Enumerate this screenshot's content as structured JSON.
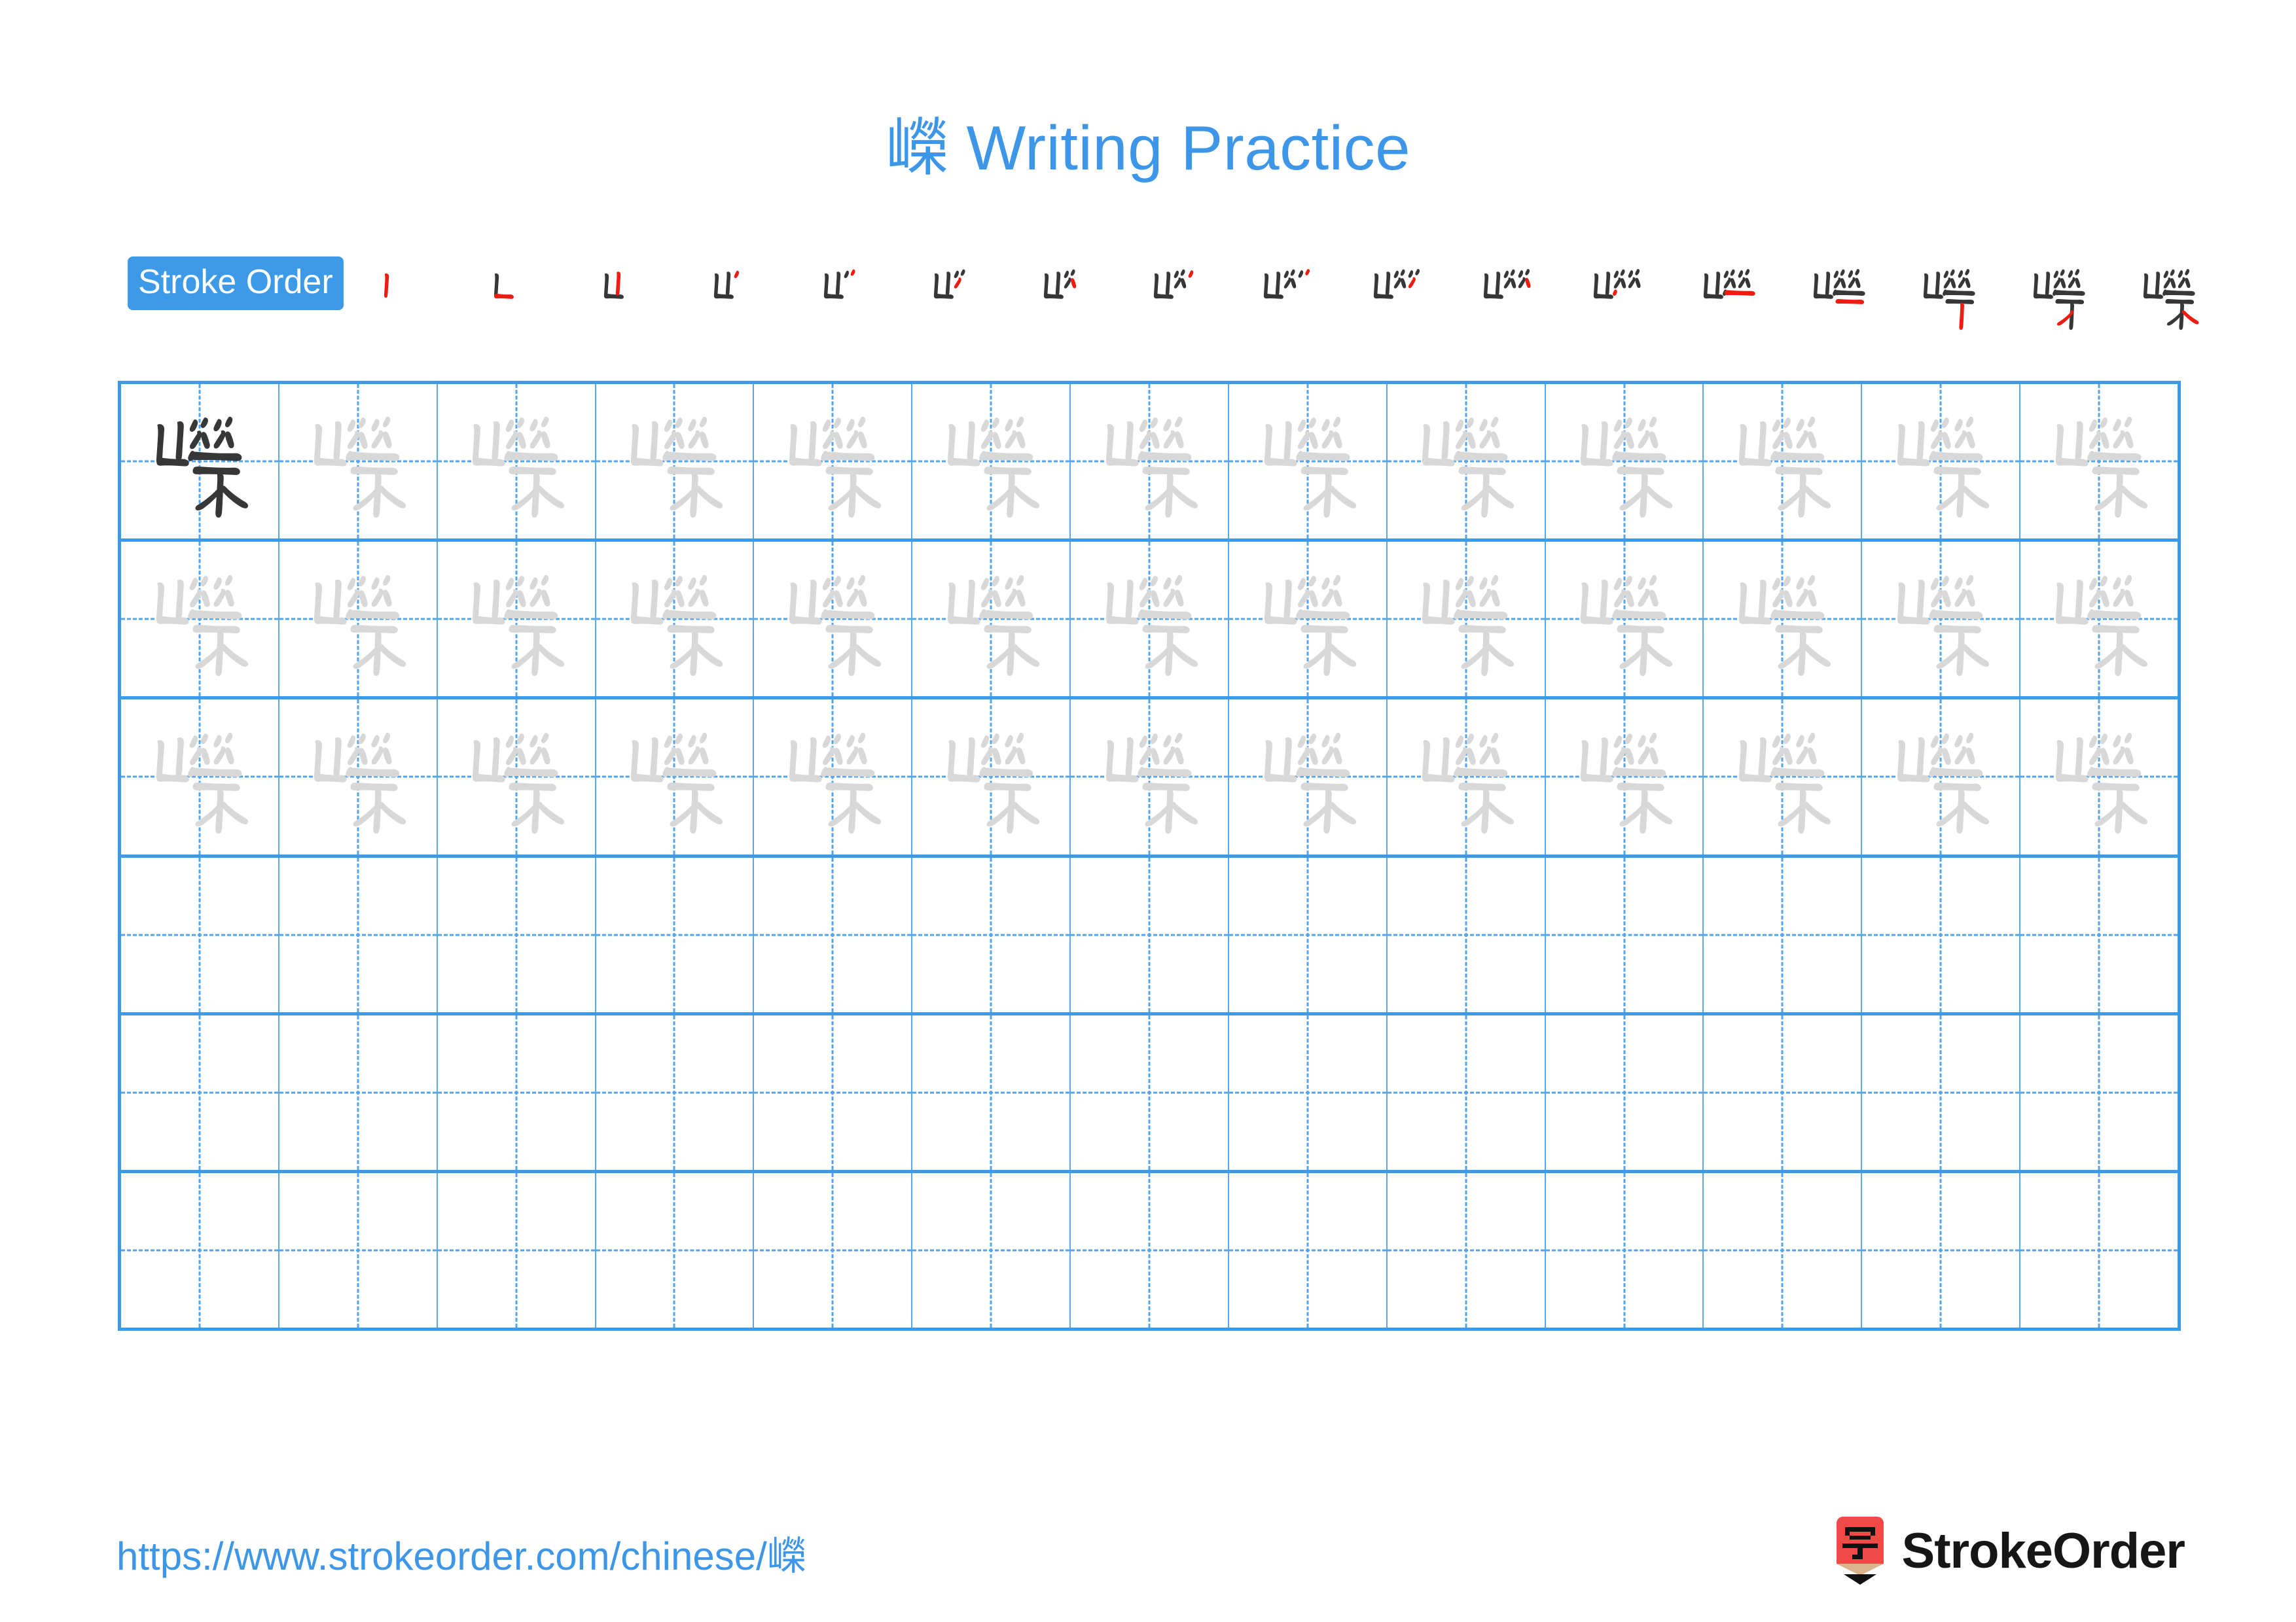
{
  "character": "嶸",
  "title": {
    "character": "嶸",
    "suffix": " Writing Practice",
    "full": "嶸 Writing Practice",
    "color": "#3d96e8"
  },
  "stroke_order": {
    "label": "Stroke Order",
    "badge_bg": "#3d9ae8",
    "badge_text_color": "#ffffff",
    "total_strokes": 17,
    "completed_stroke_color": "#373737",
    "new_stroke_color": "#ef1c12",
    "steps": [
      1,
      2,
      3,
      4,
      5,
      6,
      7,
      8,
      9,
      10,
      11,
      12,
      13,
      14,
      15,
      16,
      17
    ]
  },
  "practice_grid": {
    "columns": 13,
    "rows": 6,
    "border_color": "#3d9ae8",
    "inner_line_color": "#5aa8ea",
    "guide_line_color": "#53a4ea",
    "model_character_color": "#373737",
    "trace_character_color": "#d8d8d8",
    "rows_data": [
      {
        "index": 1,
        "cells": [
          "model",
          "trace",
          "trace",
          "trace",
          "trace",
          "trace",
          "trace",
          "trace",
          "trace",
          "trace",
          "trace",
          "trace",
          "trace"
        ]
      },
      {
        "index": 2,
        "cells": [
          "trace",
          "trace",
          "trace",
          "trace",
          "trace",
          "trace",
          "trace",
          "trace",
          "trace",
          "trace",
          "trace",
          "trace",
          "trace"
        ]
      },
      {
        "index": 3,
        "cells": [
          "trace",
          "trace",
          "trace",
          "trace",
          "trace",
          "trace",
          "trace",
          "trace",
          "trace",
          "trace",
          "trace",
          "trace",
          "trace"
        ]
      },
      {
        "index": 4,
        "cells": [
          "empty",
          "empty",
          "empty",
          "empty",
          "empty",
          "empty",
          "empty",
          "empty",
          "empty",
          "empty",
          "empty",
          "empty",
          "empty"
        ]
      },
      {
        "index": 5,
        "cells": [
          "empty",
          "empty",
          "empty",
          "empty",
          "empty",
          "empty",
          "empty",
          "empty",
          "empty",
          "empty",
          "empty",
          "empty",
          "empty"
        ]
      },
      {
        "index": 6,
        "cells": [
          "empty",
          "empty",
          "empty",
          "empty",
          "empty",
          "empty",
          "empty",
          "empty",
          "empty",
          "empty",
          "empty",
          "empty",
          "empty"
        ]
      }
    ]
  },
  "footer": {
    "url": "https://www.strokeorder.com/chinese/嶸",
    "url_color": "#3d96e8",
    "brand_name": "StrokeOrder",
    "brand_logo_character": "字",
    "brand_logo_bg": "#f04a48",
    "brand_logo_tip": "#dcb48c",
    "brand_name_color": "#161616"
  }
}
